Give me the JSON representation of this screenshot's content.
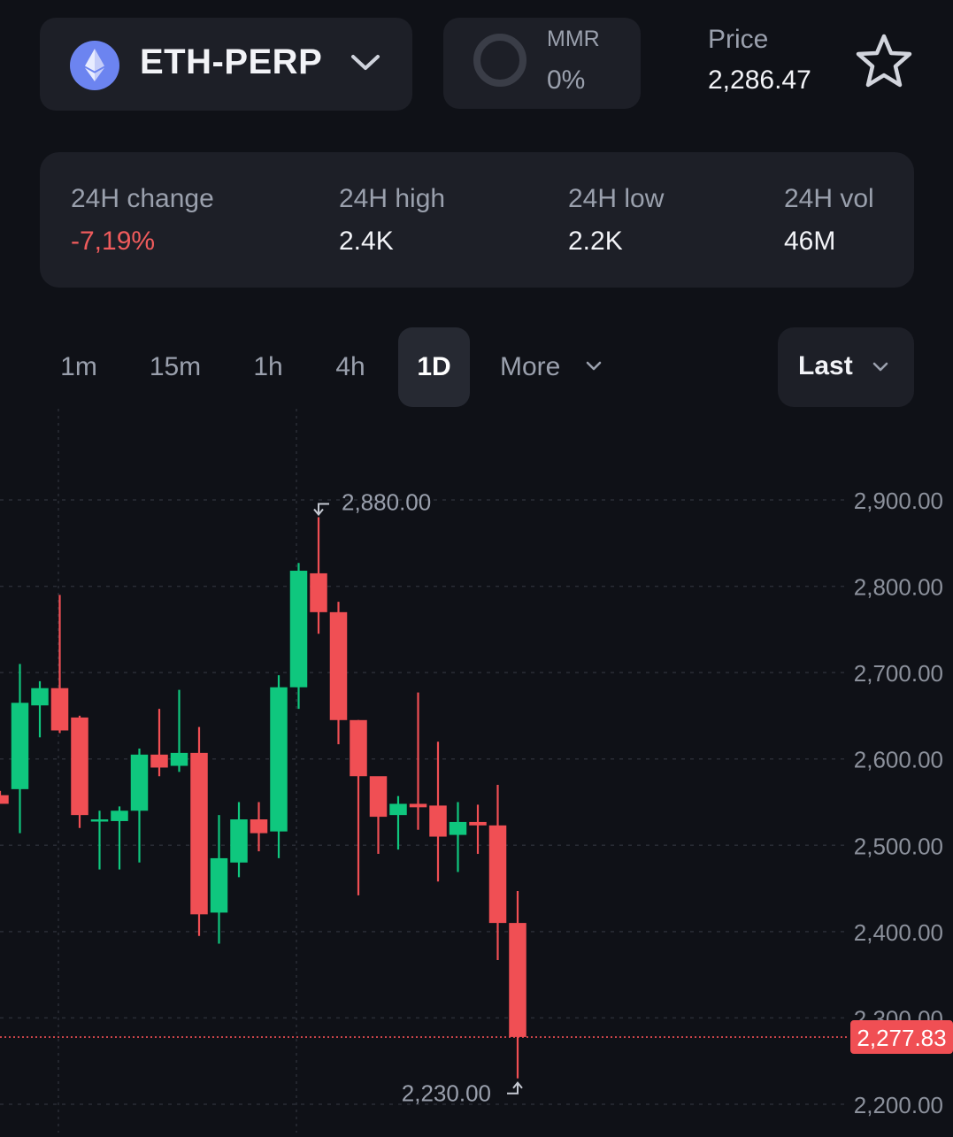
{
  "header": {
    "market": "ETH-PERP",
    "market_icon": "ethereum-icon",
    "mmr_label": "MMR",
    "mmr_value": "0%",
    "price_label": "Price",
    "price_value": "2,286.47",
    "favorite_icon": "star-icon"
  },
  "stats": [
    {
      "label": "24H change",
      "value": "-7,19%",
      "negative": true
    },
    {
      "label": "24H high",
      "value": "2.4K"
    },
    {
      "label": "24H low",
      "value": "2.2K"
    },
    {
      "label": "24H vol",
      "value": "46M"
    }
  ],
  "timeframes": {
    "options": [
      "1m",
      "15m",
      "1h",
      "4h",
      "1D"
    ],
    "selected": "1D",
    "more_label": "More",
    "price_type_label": "Last"
  },
  "colors": {
    "up": "#0fc77e",
    "down": "#f04f54",
    "background": "#0f1117",
    "panel": "#1d1f27",
    "negative_text": "#ef5b5c"
  },
  "chart_data": {
    "type": "candlestick",
    "y_axis": {
      "ticks": [
        2200,
        2300,
        2400,
        2500,
        2600,
        2700,
        2800,
        2900
      ],
      "tick_labels": [
        "2,200.00",
        "2,300.00",
        "2,400.00",
        "2,500.00",
        "2,600.00",
        "2,700.00",
        "2,800.00",
        "2,900.00"
      ],
      "range": [
        2190,
        2940
      ],
      "position": "right"
    },
    "grid": true,
    "last_price": 2277.83,
    "last_price_label": "2,277.83",
    "high_marker": {
      "value": 2880,
      "label": "2,880.00"
    },
    "low_marker": {
      "value": 2230,
      "label": "2,230.00"
    },
    "candles": [
      {
        "o": 2558,
        "h": 2563,
        "l": 2550,
        "c": 2548
      },
      {
        "o": 2565,
        "h": 2710,
        "l": 2514,
        "c": 2665
      },
      {
        "o": 2662,
        "h": 2690,
        "l": 2625,
        "c": 2682
      },
      {
        "o": 2682,
        "h": 2790,
        "l": 2630,
        "c": 2633
      },
      {
        "o": 2648,
        "h": 2650,
        "l": 2520,
        "c": 2535
      },
      {
        "o": 2530,
        "h": 2540,
        "l": 2472,
        "c": 2530
      },
      {
        "o": 2528,
        "h": 2545,
        "l": 2472,
        "c": 2540
      },
      {
        "o": 2540,
        "h": 2612,
        "l": 2480,
        "c": 2605
      },
      {
        "o": 2605,
        "h": 2658,
        "l": 2580,
        "c": 2590
      },
      {
        "o": 2592,
        "h": 2680,
        "l": 2585,
        "c": 2607
      },
      {
        "o": 2607,
        "h": 2637,
        "l": 2395,
        "c": 2420
      },
      {
        "o": 2422,
        "h": 2535,
        "l": 2386,
        "c": 2485
      },
      {
        "o": 2480,
        "h": 2550,
        "l": 2463,
        "c": 2530
      },
      {
        "o": 2530,
        "h": 2550,
        "l": 2493,
        "c": 2514
      },
      {
        "o": 2516,
        "h": 2697,
        "l": 2485,
        "c": 2683
      },
      {
        "o": 2683,
        "h": 2827,
        "l": 2658,
        "c": 2818
      },
      {
        "o": 2815,
        "h": 2880,
        "l": 2745,
        "c": 2770
      },
      {
        "o": 2770,
        "h": 2782,
        "l": 2617,
        "c": 2645
      },
      {
        "o": 2645,
        "h": 2645,
        "l": 2442,
        "c": 2580
      },
      {
        "o": 2580,
        "h": 2575,
        "l": 2490,
        "c": 2533
      },
      {
        "o": 2535,
        "h": 2557,
        "l": 2495,
        "c": 2548
      },
      {
        "o": 2548,
        "h": 2677,
        "l": 2518,
        "c": 2544
      },
      {
        "o": 2546,
        "h": 2620,
        "l": 2458,
        "c": 2510
      },
      {
        "o": 2512,
        "h": 2550,
        "l": 2469,
        "c": 2527
      },
      {
        "o": 2527,
        "h": 2547,
        "l": 2490,
        "c": 2523
      },
      {
        "o": 2523,
        "h": 2570,
        "l": 2367,
        "c": 2410
      },
      {
        "o": 2410,
        "h": 2447,
        "l": 2230,
        "c": 2278
      }
    ]
  }
}
